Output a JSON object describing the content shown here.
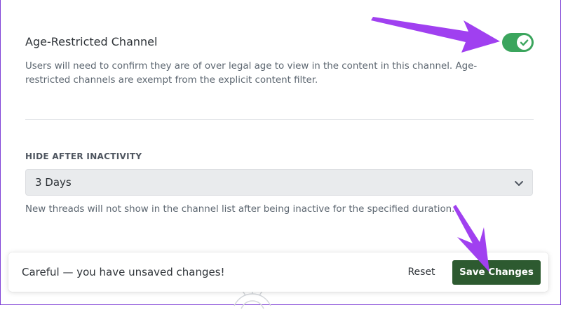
{
  "age_restricted": {
    "title": "Age-Restricted Channel",
    "enabled": true,
    "description": "Users will need to confirm they are of over legal age to view in the content in this channel. Age-restricted channels are exempt from the explicit content filter."
  },
  "hide_after_inactivity": {
    "label": "HIDE AFTER INACTIVITY",
    "selected": "3 Days",
    "help": "New threads will not show in the channel list after being inactive for the specified duration."
  },
  "unsaved_notice": {
    "message": "Careful — you have unsaved changes!",
    "reset_label": "Reset",
    "save_label": "Save Changes"
  },
  "icons": {
    "toggle": "checkmark-icon",
    "select": "chevron-down-icon",
    "background": "gear-icon"
  },
  "colors": {
    "toggle_on": "#3ba55d",
    "save_button": "#2d5a30",
    "annotation_arrow": "#a040f0"
  }
}
